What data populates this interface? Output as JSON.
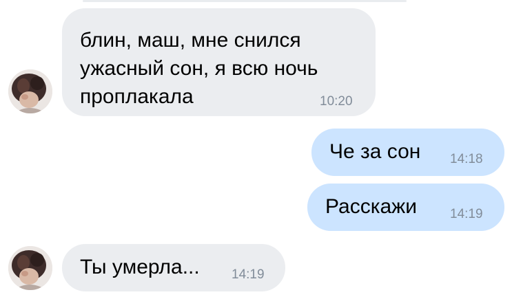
{
  "messages": [
    {
      "direction": "incoming",
      "text": "блин, маш, мне снился\nужасный сон, я всю ночь\nпроплакала",
      "time": "10:20",
      "has_avatar": true
    },
    {
      "direction": "outgoing",
      "text": "Че за сон",
      "time": "14:18",
      "has_avatar": false
    },
    {
      "direction": "outgoing",
      "text": "Расскажи",
      "time": "14:19",
      "has_avatar": false
    },
    {
      "direction": "incoming",
      "text": "Ты умерла...",
      "time": "14:19",
      "has_avatar": true
    }
  ],
  "colors": {
    "incoming_bubble": "#ebedf0",
    "outgoing_bubble": "#cce4ff",
    "time_text": "#818c99",
    "message_text": "#000000"
  },
  "icons": {
    "avatar": "user-avatar-photo"
  }
}
